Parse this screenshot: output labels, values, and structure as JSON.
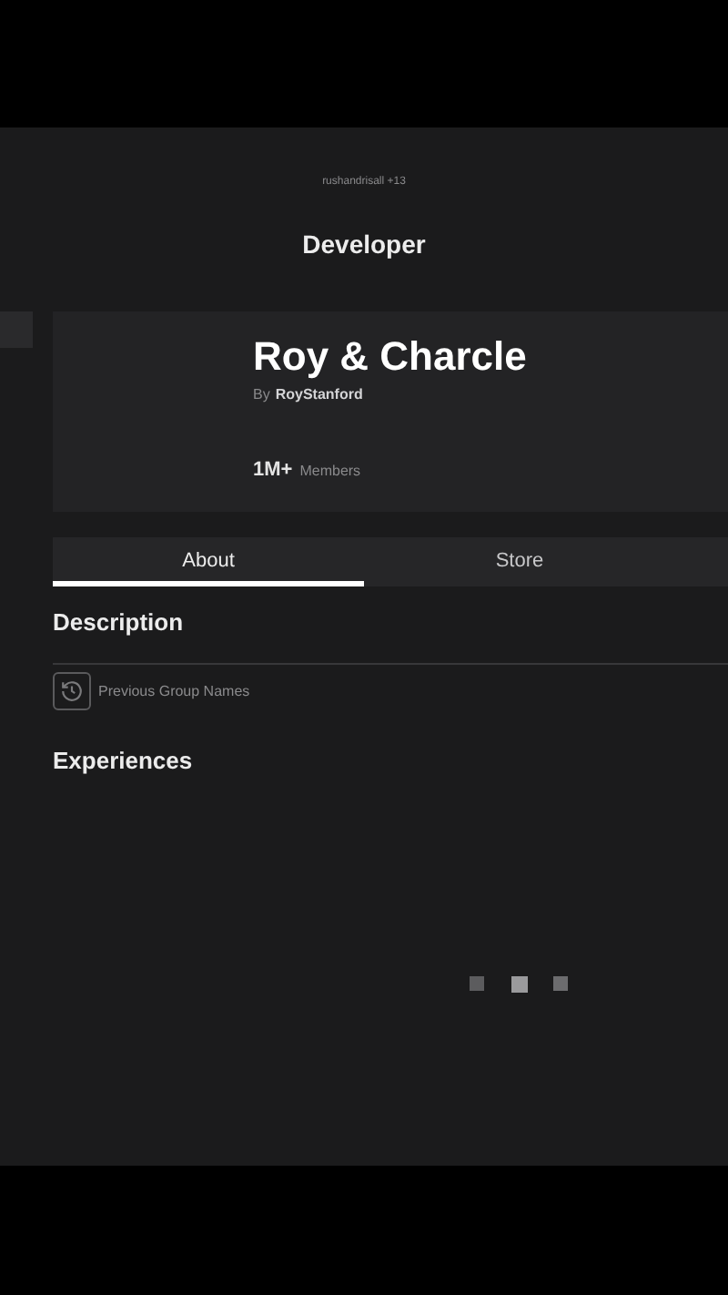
{
  "header": {
    "subtitle": "rushandrisall +13",
    "title": "Developer"
  },
  "group": {
    "name": "Roy & Charcle",
    "by_label": "By",
    "owner": "RoyStanford",
    "member_count": "1M+",
    "member_label": "Members"
  },
  "tabs": [
    {
      "label": "About",
      "selected": true
    },
    {
      "label": "Store",
      "selected": false
    }
  ],
  "description": {
    "heading": "Description"
  },
  "previous_names": {
    "label": "Previous Group Names"
  },
  "experiences": {
    "heading": "Experiences"
  }
}
